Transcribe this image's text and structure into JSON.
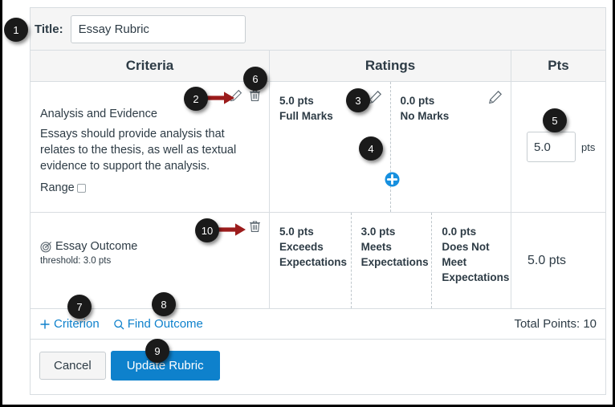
{
  "dialog": {
    "title_label": "Title:",
    "title_value": "Essay Rubric"
  },
  "table": {
    "headers": {
      "criteria": "Criteria",
      "ratings": "Ratings",
      "pts": "Pts"
    },
    "rows": [
      {
        "type": "criterion",
        "name": "Analysis and Evidence",
        "description": "Essays should provide analysis that relates to the thesis, as well as textual evidence to support the analysis.",
        "range_label": "Range",
        "range_checked": false,
        "ratings": [
          {
            "points": "5.0 pts",
            "description": "Full Marks"
          },
          {
            "points": "0.0 pts",
            "description": "No Marks"
          }
        ],
        "points_value": "5.0",
        "points_unit": "pts"
      },
      {
        "type": "outcome",
        "name": "Essay Outcome",
        "threshold": "threshold: 3.0 pts",
        "ratings": [
          {
            "points": "5.0 pts",
            "description": "Exceeds Expectations"
          },
          {
            "points": "3.0 pts",
            "description": "Meets Expectations"
          },
          {
            "points": "0.0 pts",
            "description": "Does Not Meet Expectations"
          }
        ],
        "points_static": "5.0 pts"
      }
    ]
  },
  "footer": {
    "add_criterion": "Criterion",
    "find_outcome": "Find Outcome",
    "total_points": "Total Points: 10"
  },
  "actions": {
    "cancel": "Cancel",
    "update": "Update Rubric"
  },
  "icons": {
    "pencil": "pencil-icon",
    "trash": "trash-icon",
    "plus_circle": "plus-circle-icon",
    "outcome": "outcome-target-icon",
    "plus": "plus-icon",
    "search": "search-icon"
  },
  "annotations": [
    {
      "id": "1",
      "number": "1"
    },
    {
      "id": "2",
      "number": "2"
    },
    {
      "id": "3",
      "number": "3"
    },
    {
      "id": "4",
      "number": "4"
    },
    {
      "id": "5",
      "number": "5"
    },
    {
      "id": "6",
      "number": "6"
    },
    {
      "id": "7",
      "number": "7"
    },
    {
      "id": "8",
      "number": "8"
    },
    {
      "id": "9",
      "number": "9"
    },
    {
      "id": "10",
      "number": "10"
    }
  ],
  "colors": {
    "accent": "#0e81cc",
    "arrow": "#9c1c1c",
    "badge": "#1a1a1a",
    "text": "#2d3b45",
    "border": "#d8dde1"
  }
}
